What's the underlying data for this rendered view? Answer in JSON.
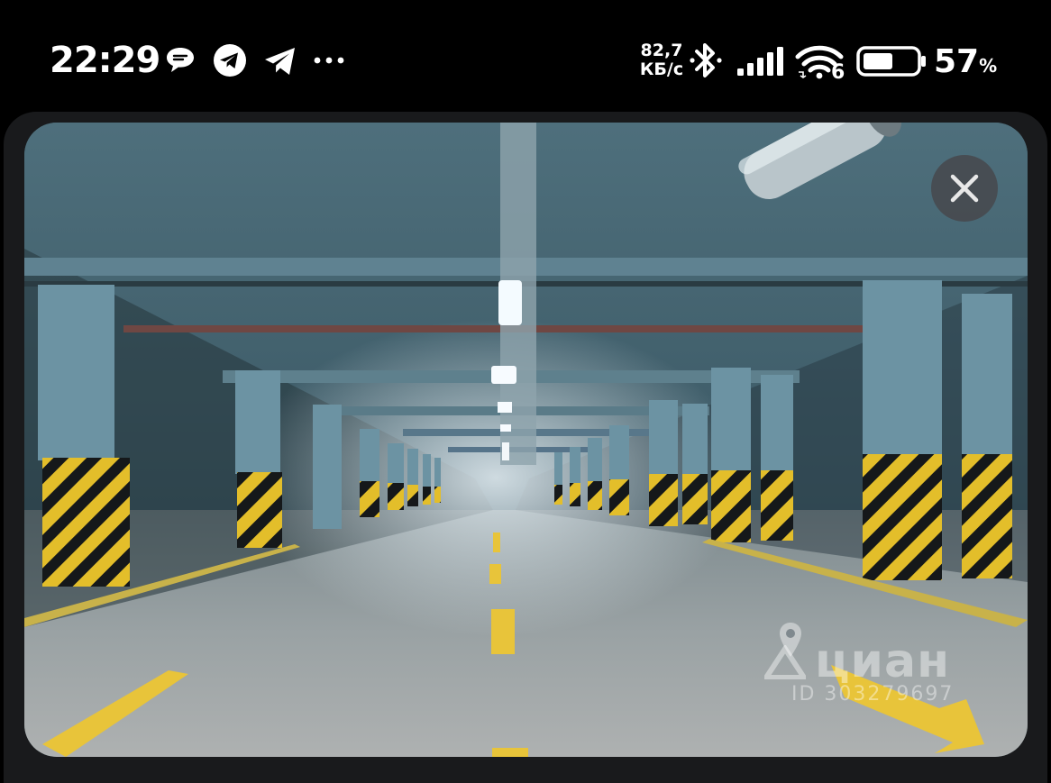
{
  "status_bar": {
    "time": "22:29",
    "notification_icons": [
      "chat-bubble-icon",
      "telegram-icon",
      "telegram-plane-icon",
      "more-dots-icon"
    ],
    "net_speed_value": "82,7",
    "net_speed_unit": "КБ/с",
    "system_icons": [
      "bluetooth-icon",
      "signal-bars-icon",
      "wifi-6-icon",
      "battery-icon"
    ],
    "wifi_badge": "6",
    "battery_level": 0.57,
    "battery_percent": "57",
    "battery_percent_sign": "%"
  },
  "viewer": {
    "close_icon": "close-icon",
    "watermark_brand": "циан",
    "watermark_id": "ID 303279697",
    "colors": {
      "card_background": "#191a1c",
      "close_button_background": "#46484c",
      "stripe_yellow": "#e6c02a",
      "lane_marking": "#e8c43a"
    }
  }
}
